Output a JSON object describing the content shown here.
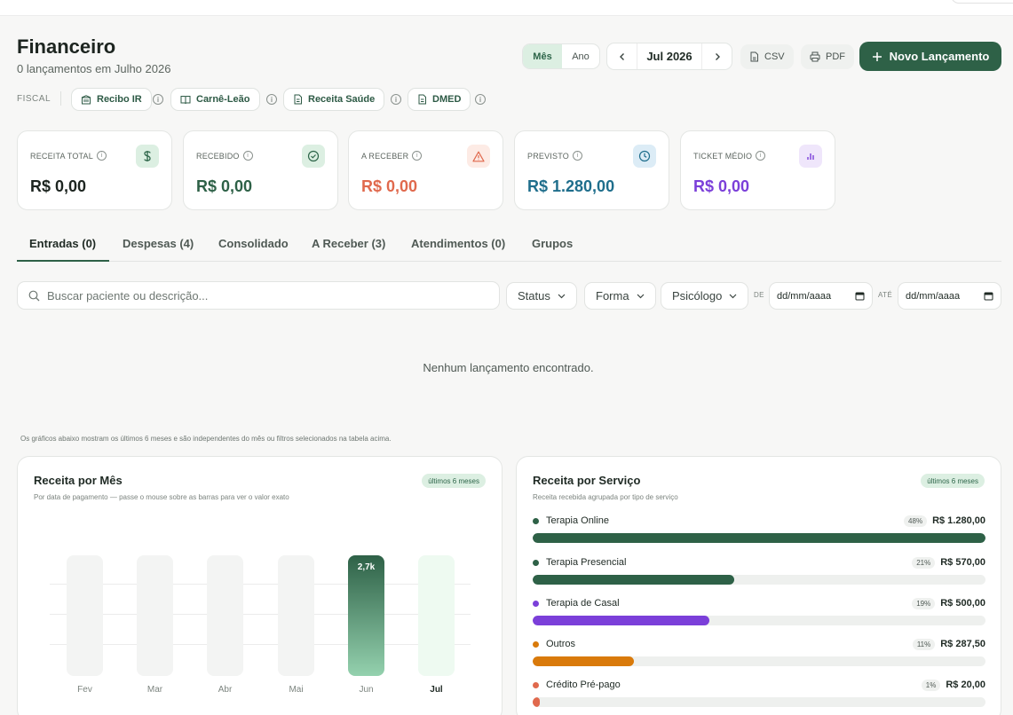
{
  "header": {
    "title": "Financeiro",
    "subtitle": "0 lançamentos em Julho 2026"
  },
  "period_toggle": {
    "month": "Mês",
    "year": "Ano",
    "selected": "Mês"
  },
  "month_nav": {
    "label": "Jul 2026"
  },
  "actions": {
    "csv": "CSV",
    "pdf": "PDF",
    "new_entry": "Novo Lançamento"
  },
  "fiscal": {
    "label": "FISCAL",
    "chips": [
      {
        "label": "Recibo IR",
        "icon": "building-icon"
      },
      {
        "label": "Carnê-Leão",
        "icon": "book-icon"
      },
      {
        "label": "Receita Saúde",
        "icon": "file-icon"
      },
      {
        "label": "DMED",
        "icon": "file-icon"
      }
    ]
  },
  "kpis": [
    {
      "label": "RECEITA TOTAL",
      "value": "R$ 0,00",
      "color": "#1d2520",
      "icon": "dollar-icon",
      "icon_bg": "#dcefe2",
      "icon_color": "#2d6549"
    },
    {
      "label": "RECEBIDO",
      "value": "R$ 0,00",
      "color": "#2e6147",
      "icon": "check-circle-icon",
      "icon_bg": "#dcefe2",
      "icon_color": "#2d6549"
    },
    {
      "label": "A RECEBER",
      "value": "R$ 0,00",
      "color": "#e0694d",
      "icon": "warning-icon",
      "icon_bg": "#fdebe5",
      "icon_color": "#e0694d"
    },
    {
      "label": "PREVISTO",
      "value": "R$ 1.280,00",
      "color": "#1f6e8c",
      "icon": "clock-icon",
      "icon_bg": "#dcecf6",
      "icon_color": "#1f6e8c"
    },
    {
      "label": "TICKET MÉDIO",
      "value": "R$ 0,00",
      "color": "#7b3fd9",
      "icon": "bar-chart-icon",
      "icon_bg": "#efe6fb",
      "icon_color": "#7b3fd9"
    }
  ],
  "tabs": [
    "Entradas (0)",
    "Despesas (4)",
    "Consolidado",
    "A Receber (3)",
    "Atendimentos (0)",
    "Grupos"
  ],
  "filters": {
    "search_placeholder": "Buscar paciente ou descrição...",
    "status": "Status",
    "forma": "Forma",
    "psicologo": "Psicólogo",
    "de_label": "DE",
    "ate_label": "ATÉ",
    "date_placeholder": "dd/mm/aaaa"
  },
  "empty_message": "Nenhum lançamento encontrado.",
  "charts_note": "Os gráficos abaixo mostram os últimos 6 meses e são independentes do mês ou filtros selecionados na tabela acima.",
  "revenue_by_month": {
    "title": "Receita por Mês",
    "subtitle": "Por data de pagamento — passe o mouse sobre as barras para ver o valor exato",
    "badge": "últimos 6 meses",
    "value_label": "2,7k"
  },
  "revenue_by_service": {
    "title": "Receita por Serviço",
    "subtitle": "Receita recebida agrupada por tipo de serviço",
    "badge": "últimos 6 meses",
    "items": [
      {
        "name": "Terapia Online",
        "pct": "48%",
        "amount": "R$ 1.280,00",
        "share": 1.0,
        "color": "#2e6147"
      },
      {
        "name": "Terapia Presencial",
        "pct": "21%",
        "amount": "R$ 570,00",
        "share": 0.445,
        "color": "#2e6147"
      },
      {
        "name": "Terapia de Casal",
        "pct": "19%",
        "amount": "R$ 500,00",
        "share": 0.391,
        "color": "#7b3fd9"
      },
      {
        "name": "Outros",
        "pct": "11%",
        "amount": "R$ 287,50",
        "share": 0.224,
        "color": "#d97a0b"
      },
      {
        "name": "Crédito Pré-pago",
        "pct": "1%",
        "amount": "R$ 20,00",
        "share": 0.016,
        "color": "#e0694d"
      }
    ]
  },
  "chart_data": {
    "type": "bar",
    "categories": [
      "Fev",
      "Mar",
      "Abr",
      "Mai",
      "Jun",
      "Jul"
    ],
    "values": [
      0,
      0,
      0,
      0,
      2700,
      0
    ],
    "data_labels": [
      "",
      "",
      "",
      "",
      "2,7k",
      ""
    ],
    "highlight_category": "Jul",
    "title": "Receita por Mês",
    "xlabel": "",
    "ylabel": "",
    "grid": true
  }
}
